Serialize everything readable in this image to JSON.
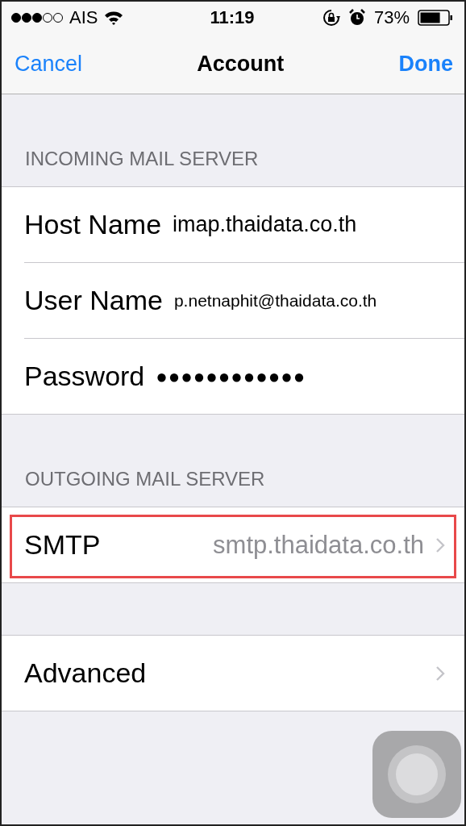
{
  "status_bar": {
    "carrier": "AIS",
    "time": "11:19",
    "battery": "73%"
  },
  "nav": {
    "cancel": "Cancel",
    "title": "Account",
    "done": "Done"
  },
  "sections": [
    {
      "header": "INCOMING MAIL SERVER",
      "rows": [
        {
          "kind": "field",
          "label": "Host Name",
          "value": "imap.thaidata.co.th"
        },
        {
          "kind": "field",
          "label": "User Name",
          "value": "p.netnaphit@thaidata.co.th"
        },
        {
          "kind": "password",
          "label": "Password",
          "value": "●●●●●●●●●●●●"
        }
      ]
    },
    {
      "header": "OUTGOING MAIL SERVER",
      "rows": [
        {
          "kind": "link",
          "label": "SMTP",
          "value": "smtp.thaidata.co.th",
          "highlighted": true
        }
      ]
    },
    {
      "rows": [
        {
          "kind": "link",
          "label": "Advanced"
        }
      ]
    }
  ]
}
